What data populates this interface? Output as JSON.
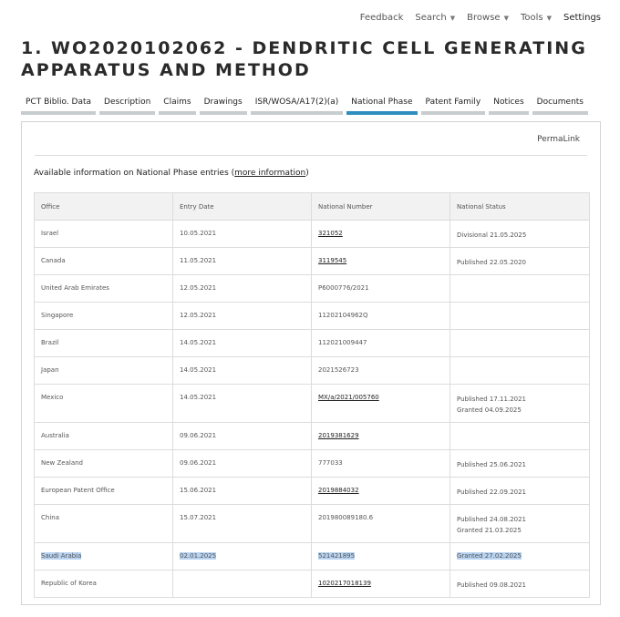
{
  "topnav": {
    "feedback": "Feedback",
    "search": "Search",
    "browse": "Browse",
    "tools": "Tools",
    "settings": "Settings"
  },
  "title": "1. WO2020102062 - DENDRITIC CELL GENERATING APPARATUS AND METHOD",
  "tabs": [
    {
      "label": "PCT Biblio. Data"
    },
    {
      "label": "Description"
    },
    {
      "label": "Claims"
    },
    {
      "label": "Drawings"
    },
    {
      "label": "ISR/WOSA/A17(2)(a)"
    },
    {
      "label": "National Phase"
    },
    {
      "label": "Patent Family"
    },
    {
      "label": "Notices"
    },
    {
      "label": "Documents"
    }
  ],
  "permalink": "PermaLink",
  "intro": {
    "prefix": "Available information on National Phase entries (",
    "link": "more information",
    "suffix": ")"
  },
  "table": {
    "headers": [
      "Office",
      "Entry Date",
      "National Number",
      "National Status"
    ],
    "rows": [
      {
        "office": "Israel",
        "date": "10.05.2021",
        "number": "321052",
        "status1": "Divisional 21.05.2025",
        "status2": ""
      },
      {
        "office": "Canada",
        "date": "11.05.2021",
        "number": "3119545",
        "status1": "Published 22.05.2020",
        "status2": ""
      },
      {
        "office": "United Arab Emirates",
        "date": "12.05.2021",
        "number": "P6000776/2021",
        "status1": "",
        "status2": ""
      },
      {
        "office": "Singapore",
        "date": "12.05.2021",
        "number": "11202104962Q",
        "status1": "",
        "status2": ""
      },
      {
        "office": "Brazil",
        "date": "14.05.2021",
        "number": "112021009447",
        "status1": "",
        "status2": ""
      },
      {
        "office": "Japan",
        "date": "14.05.2021",
        "number": "2021526723",
        "status1": "",
        "status2": ""
      },
      {
        "office": "Mexico",
        "date": "14.05.2021",
        "number": "MX/a/2021/005760",
        "status1": "Published 17.11.2021",
        "status2": "Granted 04.09.2025"
      },
      {
        "office": "Australia",
        "date": "09.06.2021",
        "number": "2019381629",
        "status1": "",
        "status2": ""
      },
      {
        "office": "New Zealand",
        "date": "09.06.2021",
        "number": "777033",
        "status1": "Published 25.06.2021",
        "status2": ""
      },
      {
        "office": "European Patent Office",
        "date": "15.06.2021",
        "number": "2019884032",
        "status1": "Published 22.09.2021",
        "status2": ""
      },
      {
        "office": "China",
        "date": "15.07.2021",
        "number": "201980089180.6",
        "status1": "Published 24.08.2021",
        "status2": "Granted 21.03.2025"
      },
      {
        "office": "Saudi Arabia",
        "date": "02.01.2025",
        "number": "521421895",
        "status1": "Granted 27.02.2025",
        "status2": ""
      },
      {
        "office": "Republic of Korea",
        "date": "",
        "number": "1020217018139",
        "status1": "Published 09.08.2021",
        "status2": ""
      }
    ]
  }
}
